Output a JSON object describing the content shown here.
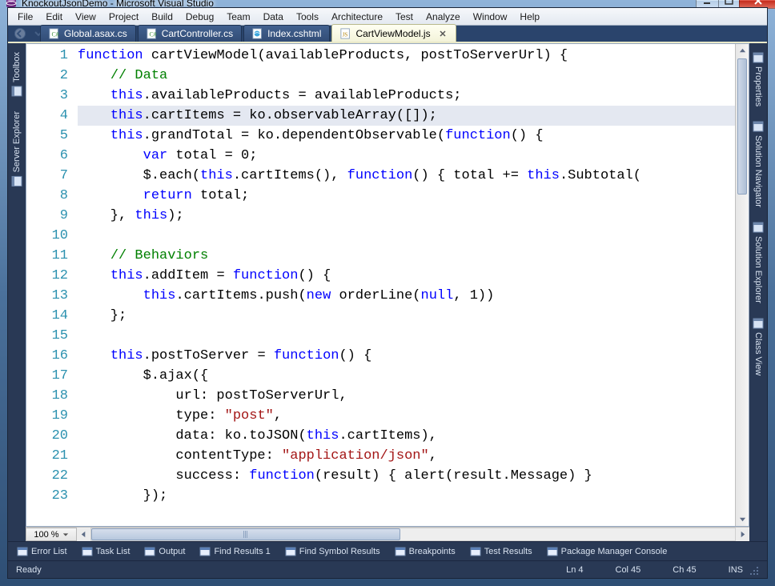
{
  "window": {
    "title": "KnockoutJsonDemo - Microsoft Visual Studio"
  },
  "menus": [
    "File",
    "Edit",
    "View",
    "Project",
    "Build",
    "Debug",
    "Team",
    "Data",
    "Tools",
    "Architecture",
    "Test",
    "Analyze",
    "Window",
    "Help"
  ],
  "tabs": [
    {
      "label": "Global.asax.cs",
      "icon": "csharp"
    },
    {
      "label": "CartController.cs",
      "icon": "csharp"
    },
    {
      "label": "Index.cshtml",
      "icon": "cshtml"
    },
    {
      "label": "CartViewModel.js",
      "icon": "js",
      "active": true
    }
  ],
  "left_panels": [
    "Toolbox",
    "Server Explorer"
  ],
  "right_panels": [
    "Properties",
    "Solution Navigator",
    "Solution Explorer",
    "Class View"
  ],
  "editor": {
    "highlight_line": 4,
    "lines": [
      [
        [
          "kw",
          "function"
        ],
        " cartViewModel(availableProducts, postToServerUrl) {"
      ],
      [
        "    ",
        [
          "cm",
          "// Data"
        ]
      ],
      [
        "    ",
        [
          "kw",
          "this"
        ],
        ".availableProducts = availableProducts;"
      ],
      [
        "    ",
        [
          "kw",
          "this"
        ],
        ".cartItems = ko.observableArray([]);"
      ],
      [
        "    ",
        [
          "kw",
          "this"
        ],
        ".grandTotal = ko.dependentObservable(",
        [
          "kw",
          "function"
        ],
        "() {"
      ],
      [
        "        ",
        [
          "kw",
          "var"
        ],
        " total = 0;"
      ],
      [
        "        $.each(",
        [
          "kw",
          "this"
        ],
        ".cartItems(), ",
        [
          "kw",
          "function"
        ],
        "() { total += ",
        [
          "kw",
          "this"
        ],
        ".Subtotal("
      ],
      [
        "        ",
        [
          "kw",
          "return"
        ],
        " total;"
      ],
      [
        "    }, ",
        [
          "kw",
          "this"
        ],
        ");"
      ],
      [
        ""
      ],
      [
        "    ",
        [
          "cm",
          "// Behaviors"
        ]
      ],
      [
        "    ",
        [
          "kw",
          "this"
        ],
        ".addItem = ",
        [
          "kw",
          "function"
        ],
        "() {"
      ],
      [
        "        ",
        [
          "kw",
          "this"
        ],
        ".cartItems.push(",
        [
          "kw",
          "new"
        ],
        " orderLine(",
        [
          "kw",
          "null"
        ],
        ", 1))"
      ],
      [
        "    };"
      ],
      [
        ""
      ],
      [
        "    ",
        [
          "kw",
          "this"
        ],
        ".postToServer = ",
        [
          "kw",
          "function"
        ],
        "() {"
      ],
      [
        "        $.ajax({"
      ],
      [
        "            url: postToServerUrl,"
      ],
      [
        "            type: ",
        [
          "str",
          "\"post\""
        ],
        ","
      ],
      [
        "            data: ko.toJSON(",
        [
          "kw",
          "this"
        ],
        ".cartItems),"
      ],
      [
        "            contentType: ",
        [
          "str",
          "\"application/json\""
        ],
        ","
      ],
      [
        "            success: ",
        [
          "kw",
          "function"
        ],
        "(result) { alert(result.Message) }"
      ],
      [
        "        });"
      ]
    ]
  },
  "zoom": "100 %",
  "output_tabs": [
    "Error List",
    "Task List",
    "Output",
    "Find Results 1",
    "Find Symbol Results",
    "Breakpoints",
    "Test Results",
    "Package Manager Console"
  ],
  "status": {
    "ready": "Ready",
    "ln": "Ln 4",
    "col": "Col 45",
    "ch": "Ch 45",
    "ins": "INS"
  }
}
